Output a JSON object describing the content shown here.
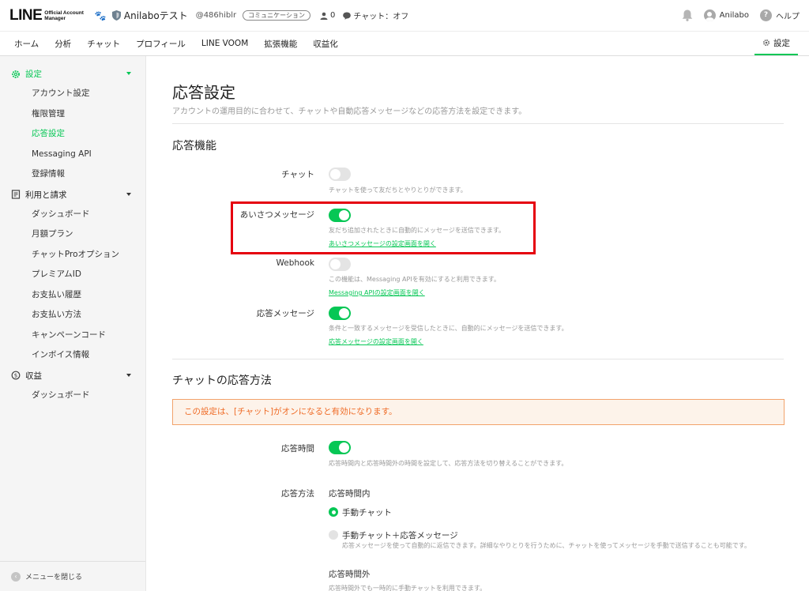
{
  "header": {
    "logo_main": "LINE",
    "logo_sub_1": "Official Account",
    "logo_sub_2": "Manager",
    "account_name": "Anilaboテスト",
    "account_id": "@486hiblr",
    "account_badge": "コミュニケーション",
    "friend_count": "0",
    "chat_status": "チャット：オフ",
    "user_name": "Anilabo",
    "help_label": "ヘルプ"
  },
  "nav": {
    "items": [
      "ホーム",
      "分析",
      "チャット",
      "プロフィール",
      "LINE VOOM",
      "拡張機能",
      "収益化"
    ],
    "settings_label": "設定"
  },
  "sidebar": {
    "settings_group": "設定",
    "settings_items": [
      "アカウント設定",
      "権限管理",
      "応答設定",
      "Messaging API",
      "登録情報"
    ],
    "billing_group": "利用と請求",
    "billing_items": [
      "ダッシュボード",
      "月額プラン",
      "チャットProオプション",
      "プレミアムID",
      "お支払い履歴",
      "お支払い方法",
      "キャンペーンコード",
      "インボイス情報"
    ],
    "revenue_group": "収益",
    "revenue_items": [
      "ダッシュボード"
    ],
    "close_label": "メニューを閉じる",
    "active_item": "応答設定"
  },
  "main": {
    "title": "応答設定",
    "subtitle": "アカウントの運用目的に合わせて、チャットや自動応答メッセージなどの応答方法を設定できます。",
    "section1_title": "応答機能",
    "chat": {
      "label": "チャット",
      "on": false,
      "desc": "チャットを使って友だちとやりとりができます。"
    },
    "greeting": {
      "label": "あいさつメッセージ",
      "on": true,
      "desc": "友だち追加されたときに自動的にメッセージを送信できます。",
      "link": "あいさつメッセージの設定画面を開く"
    },
    "webhook": {
      "label": "Webhook",
      "on": false,
      "desc": "この機能は、Messaging APIを有効にすると利用できます。",
      "link": "Messaging APIの設定画面を開く"
    },
    "auto_reply": {
      "label": "応答メッセージ",
      "on": true,
      "desc": "条件と一致するメッセージを受信したときに、自動的にメッセージを送信できます。",
      "link": "応答メッセージの設定画面を開く"
    },
    "section2_title": "チャットの応答方法",
    "notice": "この設定は、[チャット]がオンになると有効になります。",
    "response_time": {
      "label": "応答時間",
      "on": true,
      "desc": "応答時間内と応答時間外の時間を設定して、応答方法を切り替えることができます。"
    },
    "response_method": {
      "label": "応答方法",
      "in_hours_heading": "応答時間内",
      "option_manual": "手動チャット",
      "option_manual_auto": "手動チャット＋応答メッセージ",
      "option_manual_auto_desc": "応答メッセージを使って自動的に返信できます。詳細なやりとりを行うために、チャットを使ってメッセージを手動で送信することも可能です。",
      "out_hours_heading": "応答時間外",
      "out_hours_desc": "応答時間外でも一時的に手動チャットを利用できます。"
    }
  },
  "colors": {
    "brand_green": "#06c755",
    "highlight_red": "#e5000f",
    "notice_orange": "#ef6b26"
  }
}
